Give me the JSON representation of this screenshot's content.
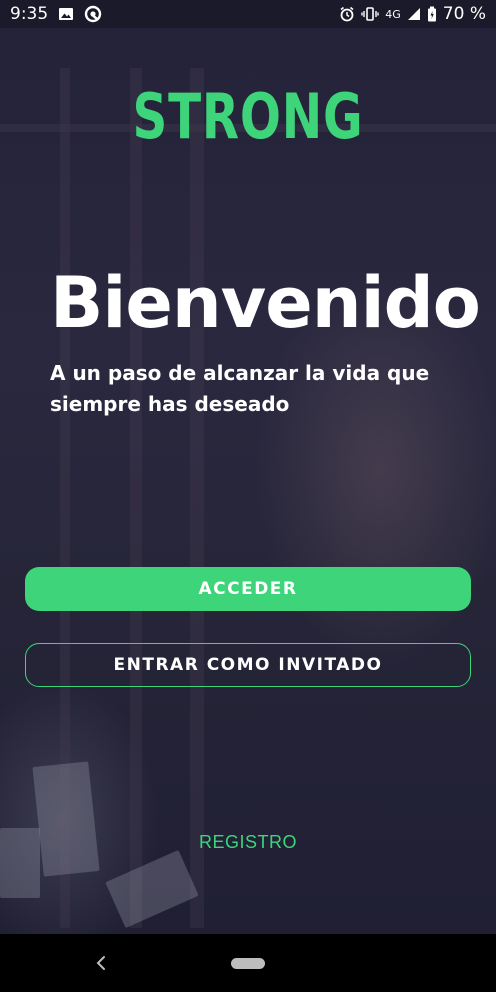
{
  "status_bar": {
    "time": "9:35",
    "network": "4G",
    "battery": "70 %",
    "left_icons": [
      "image-icon",
      "sync-icon"
    ],
    "right_icons": [
      "alarm-icon",
      "vibrate-icon",
      "signal-icon",
      "battery-icon"
    ]
  },
  "logo": {
    "text": "STRONG"
  },
  "welcome": {
    "title": "Bienvenido",
    "subtitle": "A un paso de alcanzar la vida que siempre has deseado"
  },
  "actions": {
    "login_label": "ACCEDER",
    "guest_label": "ENTRAR COMO INVITADO",
    "register_label": "REGISTRO"
  },
  "nav_bar": {
    "icons": [
      "back-icon",
      "home-pill-icon"
    ]
  },
  "colors": {
    "accent": "#3dd47a",
    "background": "#1f1e33",
    "text": "#ffffff",
    "nav_bar": "#000000"
  }
}
